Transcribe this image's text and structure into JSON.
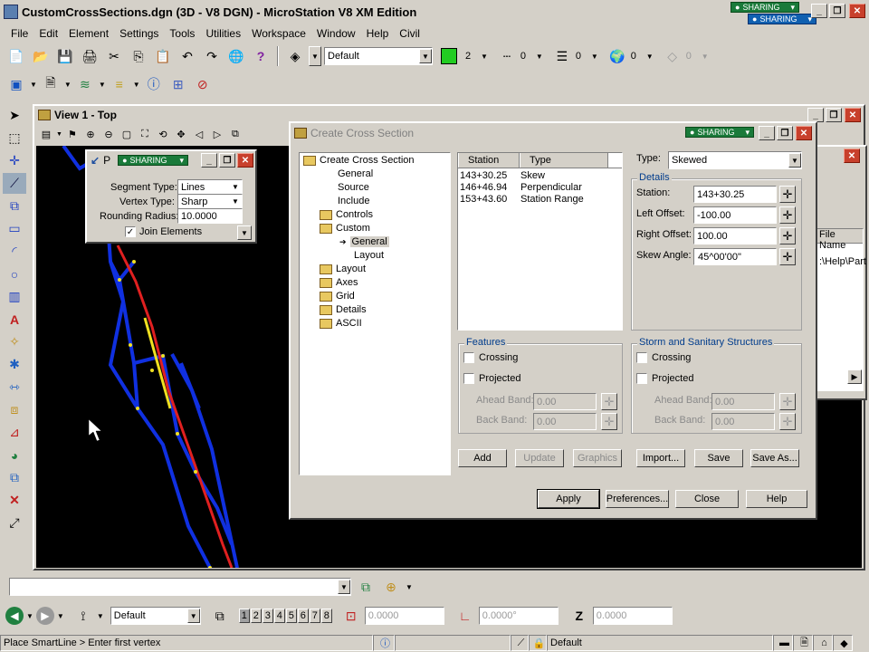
{
  "app": {
    "title": "CustomCrossSections.dgn (3D - V8 DGN) - MicroStation V8 XM Edition",
    "sharing_label": "SHARING",
    "window_min": "_",
    "window_restore": "❐",
    "window_close": "✕"
  },
  "menu": [
    "File",
    "Edit",
    "Element",
    "Settings",
    "Tools",
    "Utilities",
    "Workspace",
    "Window",
    "Help",
    "Civil"
  ],
  "toolbar": {
    "level": "Default",
    "color_value": "2",
    "color_hex": "#22cc22",
    "style_value": "0",
    "weight_value": "0",
    "class_value": "0",
    "transparency_value": "0"
  },
  "view": {
    "title": "View 1 - Top"
  },
  "smartline_dialog": {
    "title": "P",
    "segment_type_label": "Segment Type:",
    "segment_type_value": "Lines",
    "vertex_type_label": "Vertex Type:",
    "vertex_type_value": "Sharp",
    "rounding_radius_label": "Rounding Radius:",
    "rounding_radius_value": "10.0000",
    "join_elements_label": "Join Elements",
    "join_elements_checked": true
  },
  "background_dialog": {
    "column_header": "File Name",
    "row_value": ":\\Help\\Part"
  },
  "cross_section": {
    "title": "Create Cross Section",
    "tree": [
      {
        "label": "Create Cross Section",
        "level": 0,
        "folder": true
      },
      {
        "label": "General",
        "level": 1,
        "folder": false
      },
      {
        "label": "Source",
        "level": 1,
        "folder": false
      },
      {
        "label": "Include",
        "level": 1,
        "folder": false
      },
      {
        "label": "Controls",
        "level": 1,
        "folder": true
      },
      {
        "label": "Custom",
        "level": 1,
        "folder": true
      },
      {
        "label": "General",
        "level": 2,
        "folder": false,
        "selected": true
      },
      {
        "label": "Layout",
        "level": 2,
        "folder": false
      },
      {
        "label": "Layout",
        "level": 1,
        "folder": true
      },
      {
        "label": "Axes",
        "level": 1,
        "folder": true
      },
      {
        "label": "Grid",
        "level": 1,
        "folder": true
      },
      {
        "label": "Details",
        "level": 1,
        "folder": true
      },
      {
        "label": "ASCII",
        "level": 1,
        "folder": true
      }
    ],
    "list_headers": [
      "Station",
      "Type"
    ],
    "list_rows": [
      {
        "station": "143+30.25",
        "type": "Skew"
      },
      {
        "station": "146+46.94",
        "type": "Perpendicular"
      },
      {
        "station": "153+43.60",
        "type": "Station Range"
      }
    ],
    "type_label": "Type:",
    "type_value": "Skewed",
    "details_label": "Details",
    "station_label": "Station:",
    "station_value": "143+30.25",
    "left_offset_label": "Left Offset:",
    "left_offset_value": "-100.00",
    "right_offset_label": "Right Offset:",
    "right_offset_value": "100.00",
    "skew_angle_label": "Skew Angle:",
    "skew_angle_value": "45^00'00\"",
    "features": {
      "label": "Features",
      "crossing": "Crossing",
      "projected": "Projected",
      "ahead_band_label": "Ahead Band:",
      "ahead_band_value": "0.00",
      "back_band_label": "Back Band:",
      "back_band_value": "0.00"
    },
    "storm": {
      "label": "Storm and Sanitary Structures",
      "crossing": "Crossing",
      "projected": "Projected",
      "ahead_band_label": "Ahead Band:",
      "ahead_band_value": "0.00",
      "back_band_label": "Back Band:",
      "back_band_value": "0.00"
    },
    "buttons": {
      "add": "Add",
      "update": "Update",
      "graphics": "Graphics",
      "import": "Import...",
      "save": "Save",
      "save_as": "Save As...",
      "apply": "Apply",
      "preferences": "Preferences...",
      "close": "Close",
      "help": "Help"
    }
  },
  "bottom_toolbar": {
    "key_in": "",
    "level": "Default",
    "views": [
      "1",
      "2",
      "3",
      "4",
      "5",
      "6",
      "7",
      "8"
    ],
    "dist_value": "0.0000",
    "angle_value": "0.0000°",
    "z_label": "Z",
    "z_value": "0.0000"
  },
  "status": {
    "prompt": "Place SmartLine > Enter first vertex",
    "level": "Default"
  }
}
